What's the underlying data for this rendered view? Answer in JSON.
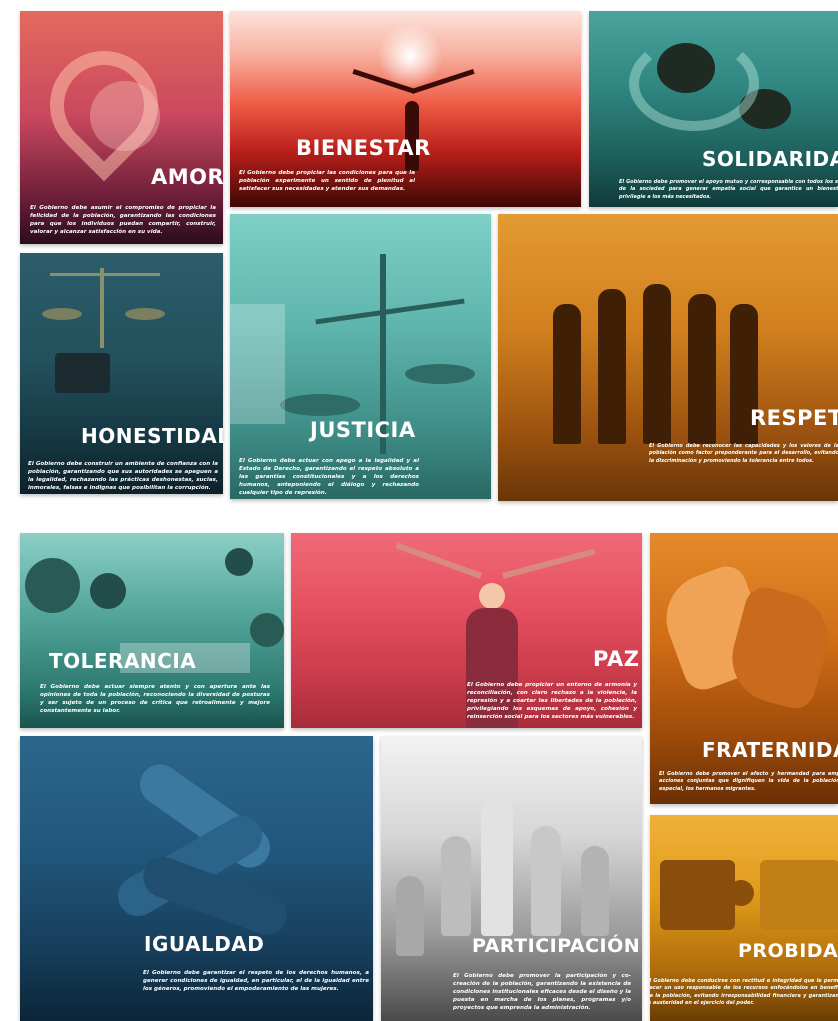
{
  "tiles": {
    "amor": {
      "title": "AMOR",
      "description": "El Gobierno debe asumir el compromiso de propiciar la felicidad de la población, garantizando las condiciones para que los individuos puedan compartir, construir, valorar y alcanzar satisfacción en su vida.",
      "color": "#d9535a"
    },
    "bienestar": {
      "title": "BIENESTAR",
      "description": "El Gobierno debe propiciar las condiciones para que la población experimente un sentido de plenitud al satisfacer sus necesidades y atender sus demandas.",
      "color": "#e8342a"
    },
    "solidaridad": {
      "title": "SOLIDARIDAD",
      "description": "El Gobierno debe promover el apoyo mutuo y corresponsable con todos los sectores de la sociedad para generar empatía social que garantice un bienestar que privilegie a los más necesitados.",
      "color": "#2f8c86"
    },
    "honestidad": {
      "title": "HONESTIDAD",
      "description": "El Gobierno debe construir un ambiente de confianza con la población, garantizando que sus autoridades se apeguen a la legalidad, rechazando las prácticas deshonestas, sucias, inmorales, falsas e indignas que posibilitan la corrupción.",
      "color": "#1f4f5c"
    },
    "justicia": {
      "title": "JUSTICIA",
      "description": "El Gobierno debe actuar con apego a la legalidad y al Estado de Derecho, garantizando el respeto absoluto a las garantías constitucionales y a los derechos humanos, anteponiendo el diálogo y rechazando cualquier tipo de represión.",
      "color": "#5fb3ac"
    },
    "respeto": {
      "title": "RESPETO",
      "description": "El Gobierno debe reconocer las capacidades y los valores de la población como factor preponderante para el desarrollo, evitando la discriminación y promoviendo la tolerancia entre todos.",
      "color": "#d9831f"
    },
    "tolerancia": {
      "title": "TOLERANCIA",
      "description": "El Gobierno debe actuar siempre atento y con apertura ante las opiniones de toda la población, reconociendo la diversidad de posturas y ser sujeto de un proceso de crítica que retroalimente y mejore constantemente su labor.",
      "color": "#3f9e93"
    },
    "paz": {
      "title": "PAZ",
      "description": "El Gobierno debe propiciar un entorno de armonía y reconciliación, con claro rechazo a la violencia, la represión y a coartar las libertades de la población, privilegiando los esquemas de apoyo, cohesión y reinserción social para los sectores más vulnerables.",
      "color": "#e84b5c"
    },
    "fraternidad": {
      "title": "FRATERNIDAD",
      "description": "El Gobierno debe promover el afecto y hermandad para emprender acciones conjuntas que dignifiquen la vida de la población y, en especial, los hermanos migrantes.",
      "color": "#d96c12"
    },
    "igualdad": {
      "title": "IGUALDAD",
      "description": "El Gobierno debe garantizar el respeto de los derechos humanos, a generar condiciones de igualdad, en particular, el de la igualdad entre los géneros, promoviendo el empoderamiento de las mujeres.",
      "color": "#1d4e73"
    },
    "participacion": {
      "title": "PARTICIPACIÓN",
      "description": "El Gobierno debe promover la participación y co-creación de la población, garantizando la existencia de condiciones institucionales eficaces desde el diseño y la puesta en marcha de los planes, programas y/o proyectos que emprenda la administración.",
      "color": "#7a7a7a"
    },
    "probidad": {
      "title": "PROBIDAD",
      "description": "El Gobierno debe conducirse con rectitud e integridad que le permita hacer un uso responsable de los recursos enfocándolos en beneficio de la población, evitando irresponsabilidad financiera y garantizando la austeridad en el ejercicio del poder.",
      "color": "#e09a1a"
    }
  }
}
